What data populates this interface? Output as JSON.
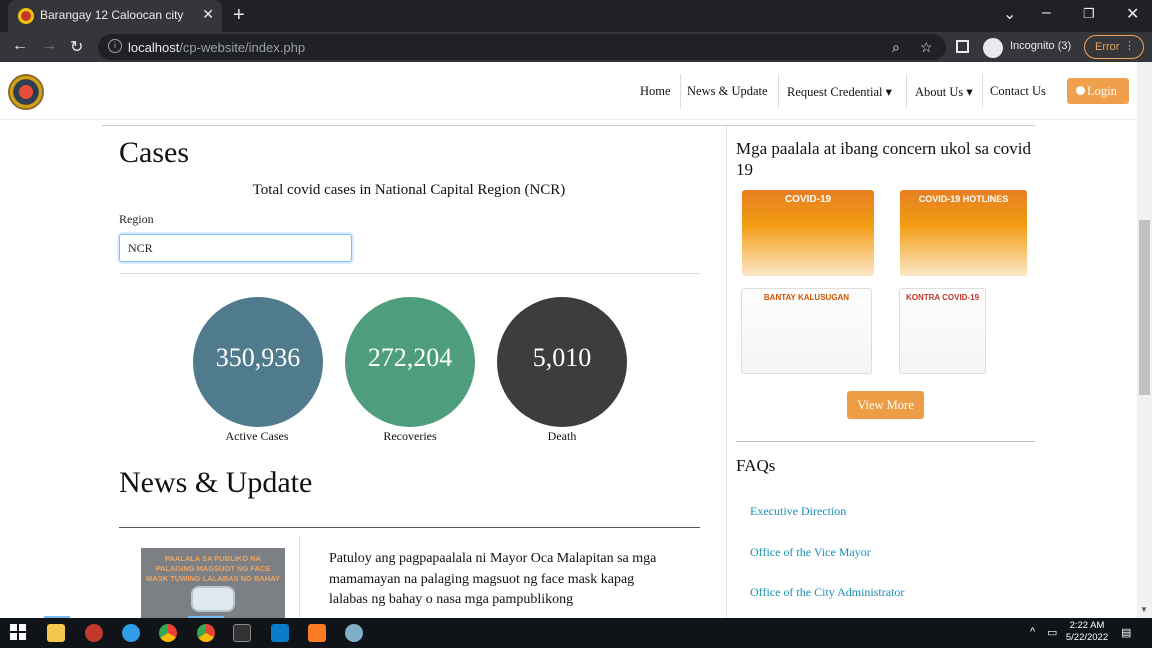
{
  "browser": {
    "tab_title": "Barangay 12 Caloocan city",
    "url_host": "localhost",
    "url_path": "/cp-website/index.php",
    "incognito_label": "Incognito (3)",
    "error_label": "Error"
  },
  "nav": {
    "items": [
      "Home",
      "News & Update",
      "Request Credential ▾",
      "About Us ▾",
      "Contact Us"
    ],
    "login_label": "Login"
  },
  "cases": {
    "heading": "Cases",
    "subtitle": "Total covid cases in National Capital Region (NCR)",
    "region_label": "Region",
    "region_value": "NCR",
    "stats": [
      {
        "value": "350,936",
        "label": "Active Cases",
        "color": "#4f7b8c"
      },
      {
        "value": "272,204",
        "label": "Recoveries",
        "color": "#4e9e7e"
      },
      {
        "value": "5,010",
        "label": "Death",
        "color": "#3d3d3d"
      }
    ]
  },
  "news": {
    "heading": "News & Update",
    "image_text": "PAALALA SA PUBLIKO NA PALAGING MAGSUOT NG FACE MASK TUWING LALABAS NG BAHAY",
    "body": "Patuloy ang pagpapaalala ni Mayor Oca Malapitan sa mga mamamayan na palaging magsuot ng face mask kapag lalabas ng bahay o nasa mga pampublikong"
  },
  "sidebar": {
    "title": "Mga paalala at ibang concern ukol sa covid 19",
    "thumbs": [
      {
        "caption": "COVID-19"
      },
      {
        "caption": "COVID-19 HOTLINES"
      },
      {
        "caption": "BANTAY KALUSUGAN"
      },
      {
        "caption": "KONTRA COVID-19"
      }
    ],
    "view_more": "View More",
    "faqs_heading": "FAQs",
    "faqs": [
      "Executive Direction",
      "Office of the Vice Mayor",
      "Office of the City Administrator"
    ]
  },
  "taskbar": {
    "time": "2:22 AM",
    "date": "5/22/2022"
  }
}
